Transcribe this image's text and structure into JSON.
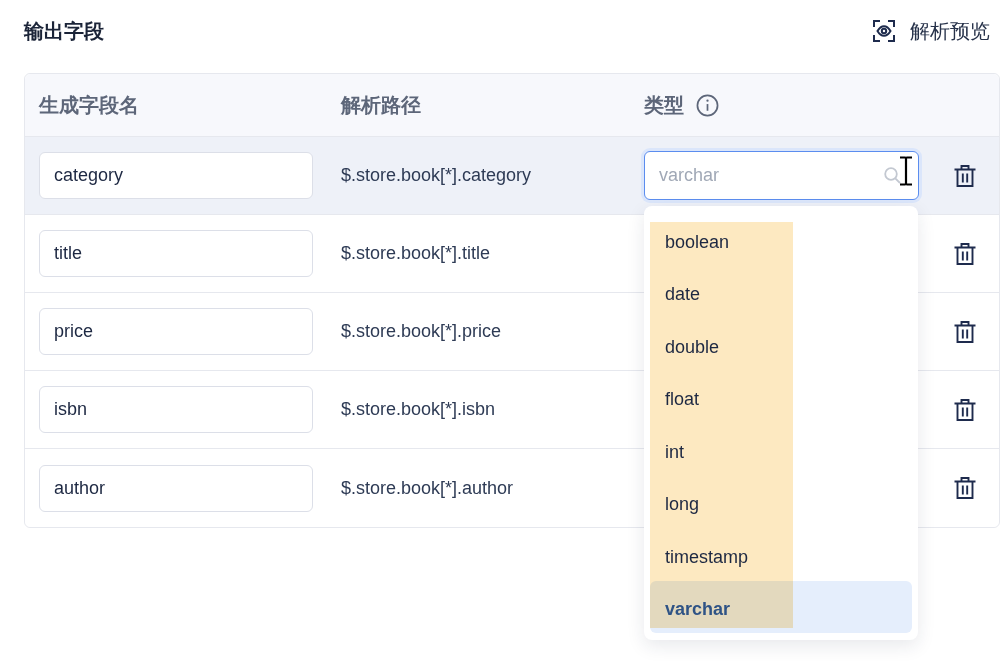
{
  "header": {
    "title": "输出字段",
    "preview_button": {
      "label": "解析预览"
    }
  },
  "table": {
    "columns": [
      {
        "label": "生成字段名",
        "info": false
      },
      {
        "label": "解析路径",
        "info": false
      },
      {
        "label": "类型",
        "info": true
      }
    ],
    "rows": [
      {
        "field_name": "category",
        "path": "$.store.book[*].category",
        "hovered": true,
        "type_select": {
          "placeholder": "varchar",
          "focused": true
        }
      },
      {
        "field_name": "title",
        "path": "$.store.book[*].title",
        "hovered": false
      },
      {
        "field_name": "price",
        "path": "$.store.book[*].price",
        "hovered": false
      },
      {
        "field_name": "isbn",
        "path": "$.store.book[*].isbn",
        "hovered": false
      },
      {
        "field_name": "author",
        "path": "$.store.book[*].author",
        "hovered": false
      }
    ]
  },
  "type_dropdown": {
    "highlight": true,
    "options": [
      {
        "label": "boolean",
        "selected": false
      },
      {
        "label": "date",
        "selected": false
      },
      {
        "label": "double",
        "selected": false
      },
      {
        "label": "float",
        "selected": false
      },
      {
        "label": "int",
        "selected": false
      },
      {
        "label": "long",
        "selected": false
      },
      {
        "label": "timestamp",
        "selected": false
      },
      {
        "label": "varchar",
        "selected": true
      }
    ]
  }
}
